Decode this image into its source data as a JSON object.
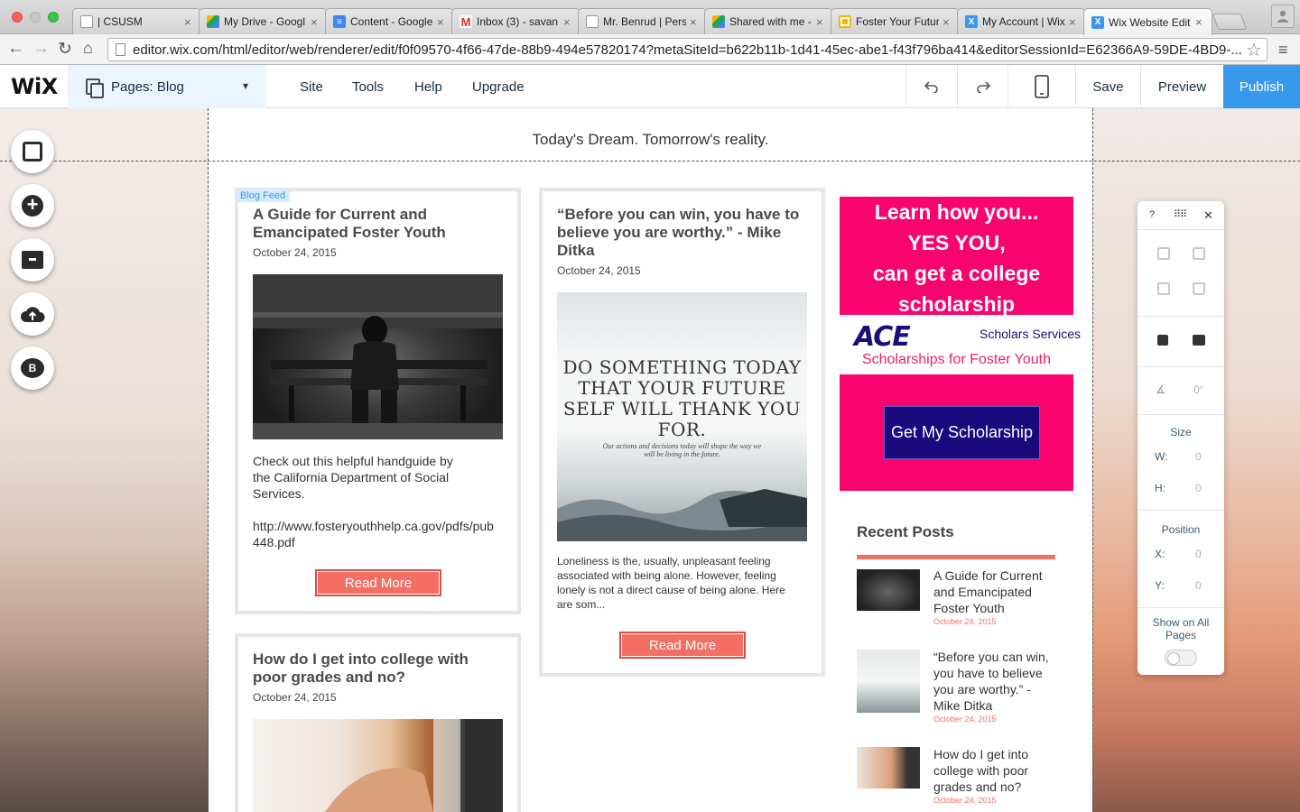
{
  "browser": {
    "tabs": [
      {
        "label": "| CSUSM",
        "icon": "page-icon",
        "color": "#ffffff"
      },
      {
        "label": "My Drive - Googl",
        "icon": "drive-icon",
        "color": "#1fa463"
      },
      {
        "label": "Content - Google",
        "icon": "docs-icon",
        "color": "#4285f4"
      },
      {
        "label": "Inbox (3) - savan",
        "icon": "gmail-icon",
        "color": "#d93025"
      },
      {
        "label": "Mr. Benrud | Pers",
        "icon": "page-icon",
        "color": "#ffffff"
      },
      {
        "label": "Shared with me -",
        "icon": "drive-icon",
        "color": "#1fa463"
      },
      {
        "label": "Foster Your Futur",
        "icon": "slides-icon",
        "color": "#f4b400"
      },
      {
        "label": "My Account | Wix",
        "icon": "wix-icon",
        "color": "#3899ec"
      },
      {
        "label": "Wix Website Edit",
        "icon": "wix-icon",
        "color": "#3899ec"
      }
    ],
    "url": "editor.wix.com/html/editor/web/renderer/edit/f0f09570-4f66-47de-88b9-494e57820174?metaSiteId=b622b11b-1d41-45ec-abe1-f43f796ba414&editorSessionId=E62366A9-59DE-4BD9-..."
  },
  "wix": {
    "logo": "WiX",
    "pages_label": "Pages: Blog",
    "menu": [
      "Site",
      "Tools",
      "Help",
      "Upgrade"
    ],
    "save": "Save",
    "preview": "Preview",
    "publish": "Publish",
    "accent": "#3899ec"
  },
  "site": {
    "tagline": "Today's Dream. Tomorrow's reality.",
    "badge": "Blog Feed",
    "posts": [
      {
        "title": "A Guide for Current and Emancipated Foster Youth",
        "date": "October 24, 2015",
        "excerpt": "Check out this helpful handguide by the California Department of Social Services.",
        "link": "http://www.fosteryouthhelp.ca.gov/pdfs/pub448.pdf",
        "read_more": "Read More"
      },
      {
        "title": "“Before you can win, you have to believe you are worthy.” - Mike Ditka",
        "date": "October 24, 2015",
        "image_quote": "DO SOMETHING TODAY THAT YOUR FUTURE SELF WILL THANK YOU FOR.",
        "image_sub": "Our actions and decisions today will shape the way we will be living in the future.",
        "excerpt": "Loneliness is the, usually, unpleasant feeling associated with being alone. However, feeling lonely is not a direct cause of being alone. Here are som...",
        "read_more": "Read More"
      },
      {
        "title": "How do I get into college with poor grades and no?",
        "date": "October 24, 2015"
      }
    ],
    "ad": {
      "headline_1": "Learn how you...",
      "headline_2": "YES YOU,",
      "headline_3": "can get a college",
      "headline_4": "scholarship",
      "logo": "ACE",
      "logo_sub": "Scholars Services",
      "tagline": "Scholarships for Foster Youth",
      "button": "Get My Scholarship",
      "pink": "#f9036e",
      "navy": "#1a0a7e"
    },
    "recent": {
      "title": "Recent Posts",
      "items": [
        {
          "title": "A Guide for Current and Emancipated Foster Youth",
          "date": "October 24, 2015"
        },
        {
          "title": "“Before you can win, you have to believe you are worthy.” - Mike Ditka",
          "date": "October 24, 2015"
        },
        {
          "title": "How do I get into college with poor grades and no?",
          "date": "October 24, 2015"
        }
      ]
    }
  },
  "panel": {
    "help": "?",
    "rotation": "0°",
    "size_label": "Size",
    "w_label": "W:",
    "w_value": "0",
    "h_label": "H:",
    "h_value": "0",
    "position_label": "Position",
    "x_label": "X:",
    "x_value": "0",
    "y_label": "Y:",
    "y_value": "0",
    "show_all": "Show on All Pages"
  }
}
